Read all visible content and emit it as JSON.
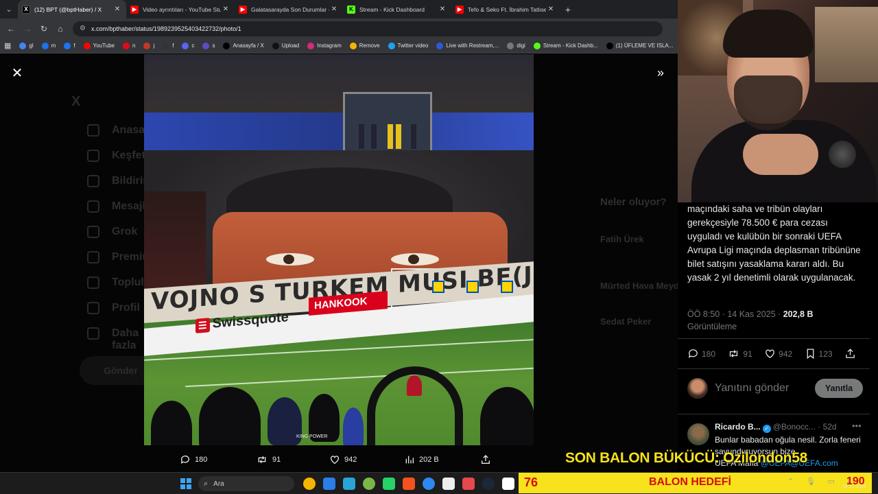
{
  "browser": {
    "tabs": [
      {
        "title": "(12) BPT (@bptHaber) / X",
        "favicon_color": "#000000",
        "favicon_glyph": "X",
        "active": true
      },
      {
        "title": "Video ayrıntıları - YouTube Stud",
        "favicon_color": "#ff0000",
        "favicon_glyph": "▶",
        "active": false
      },
      {
        "title": "Galatasarayda Son Durumlar - Y",
        "favicon_color": "#ff0000",
        "favicon_glyph": "▶",
        "active": false
      },
      {
        "title": "Stream - Kick Dashboard",
        "favicon_color": "#53fc18",
        "favicon_glyph": "K",
        "active": false
      },
      {
        "title": "Tefo & Seko Ft. İbrahim Tatlıses",
        "favicon_color": "#ff0000",
        "favicon_glyph": "▶",
        "active": false
      }
    ],
    "url": "x.com/bpthaber/status/1989239525403422732/photo/1",
    "bookmarks": [
      {
        "label": "gl",
        "color": "#4285f4"
      },
      {
        "label": "m",
        "color": "#1a73e8"
      },
      {
        "label": "f",
        "color": "#1877f2"
      },
      {
        "label": "YouTube",
        "color": "#ff0000"
      },
      {
        "label": "n",
        "color": "#e50914"
      },
      {
        "label": "j",
        "color": "#c0392b"
      },
      {
        "label": "f",
        "color": "#333333"
      },
      {
        "label": "c",
        "color": "#5865f2"
      },
      {
        "label": "s",
        "color": "#5b4cc4"
      },
      {
        "label": "Anasayfa / X",
        "color": "#000000"
      },
      {
        "label": "Upload",
        "color": "#111111"
      },
      {
        "label": "Instagram",
        "color": "#d62976"
      },
      {
        "label": "Remove",
        "color": "#f5b400"
      },
      {
        "label": "Twitter video",
        "color": "#1da1f2"
      },
      {
        "label": "Live with Restream,...",
        "color": "#2a5bd7"
      },
      {
        "label": "digi",
        "color": "#777777"
      },
      {
        "label": "Stream - Kick Dashb...",
        "color": "#53fc18"
      },
      {
        "label": "(1) ÜFLEME VE ISLA...",
        "color": "#000000"
      }
    ]
  },
  "background_page": {
    "nav": [
      "Anasayfa",
      "Keşfet",
      "Bildirimler",
      "Mesajlar",
      "Grok",
      "Premium",
      "Topluluklar",
      "Profil",
      "Daha fazla"
    ],
    "post_button": "Gönder",
    "right_heading": "Neler oluyor?",
    "trends": [
      "Fatih Ürek",
      "Mürted Hava Meydanı",
      "Sedat Peker"
    ]
  },
  "photo_text": {
    "banner": "VOJNO S TURKEM MUSI BE(J)TI",
    "ad_swissquote": "Swissquote",
    "ad_hankook": "HANKOOK",
    "kingpower": "KING POWER"
  },
  "photo_actions": {
    "replies": "180",
    "reposts": "91",
    "likes": "942",
    "views": "202 B"
  },
  "tweet": {
    "text": "maçındaki saha ve tribün olayları gerekçesiyle 78.500 € para cezası uyguladı ve kulübün bir sonraki UEFA Avrupa Ligi maçında deplasman tribününe bilet satışını yasaklama kararı aldı. Bu yasak 2 yıl denetimli olarak uygulanacak.",
    "time": "ÖÖ 8:50 · 14 Kas 2025 ·",
    "views_count": "202,8 B",
    "views_label": "Görüntüleme",
    "replies": "180",
    "reposts": "91",
    "likes": "942",
    "bookmarks": "123",
    "reply_placeholder": "Yanıtını gönder",
    "reply_button": "Yanıtla"
  },
  "reply": {
    "name": "Ricardo B...",
    "handle": "@Bonocc...",
    "age": "· 52d",
    "body": "Bunlar babadan oğula nesil. Zorla feneri savunduruyorsun bize.",
    "link_prefix": "UEFA Mafia",
    "link": "@UEFA@UEFA.com"
  },
  "overlay": {
    "title": "SON BALON BÜKÜCÜ: Ozilondon58",
    "count": "76",
    "label": "BALON HEDEFİ",
    "goal": "190"
  },
  "taskbar": {
    "search": "Ara",
    "clock_date": "14.11.2025",
    "app_colors": [
      "#f4b400",
      "#2b7de9",
      "#2aa3d8",
      "#7ab648",
      "#25d366",
      "#f4511e",
      "#2d89ef",
      "#eeeeee",
      "#e5484d",
      "#1b2838",
      "#ffffff"
    ]
  }
}
